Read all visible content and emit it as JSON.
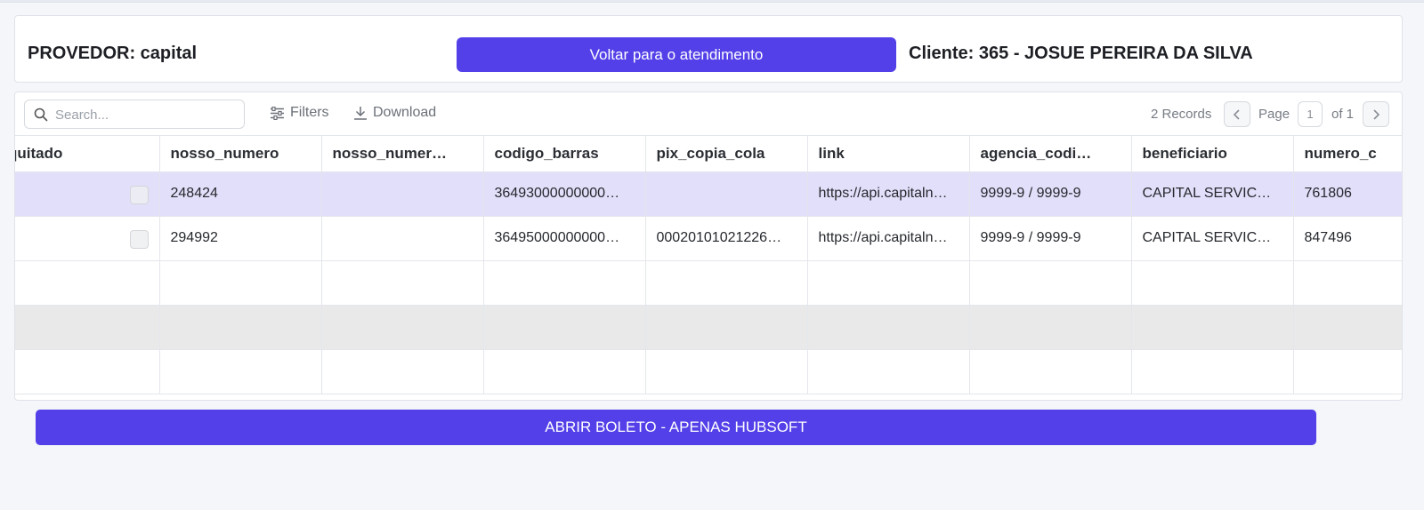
{
  "header": {
    "provider": "PROVEDOR: capital",
    "back_button": "Voltar para o atendimento",
    "client": "Cliente: 365 - JOSUE PEREIRA DA SILVA"
  },
  "toolbar": {
    "search_placeholder": "Search...",
    "filters_label": "Filters",
    "download_label": "Download",
    "records": "2 Records",
    "page_label": "Page",
    "page_number": "1",
    "of_label": "of 1"
  },
  "table": {
    "columns": [
      "quitado",
      "nosso_numero",
      "nosso_numer…",
      "codigo_barras",
      "pix_copia_cola",
      "link",
      "agencia_codi…",
      "beneficiario",
      "numero_c"
    ],
    "rows": [
      {
        "nosso_numero": "248424",
        "nosso_numero_dv": "",
        "codigo_barras": "36493000000000…",
        "pix_copia_cola": "",
        "link": "https://api.capitaln…",
        "agencia_codigo": "9999-9 / 9999-9",
        "beneficiario": "CAPITAL SERVIC…",
        "numero": "761806"
      },
      {
        "nosso_numero": "294992",
        "nosso_numero_dv": "",
        "codigo_barras": "36495000000000…",
        "pix_copia_cola": "00020101021226…",
        "link": "https://api.capitaln…",
        "agencia_codigo": "9999-9 / 9999-9",
        "beneficiario": "CAPITAL SERVIC…",
        "numero": "847496"
      }
    ]
  },
  "footer": {
    "open_button": "ABRIR BOLETO - APENAS HUBSOFT"
  },
  "colors": {
    "accent": "#5340e8",
    "selected_row": "#e2dffa"
  }
}
